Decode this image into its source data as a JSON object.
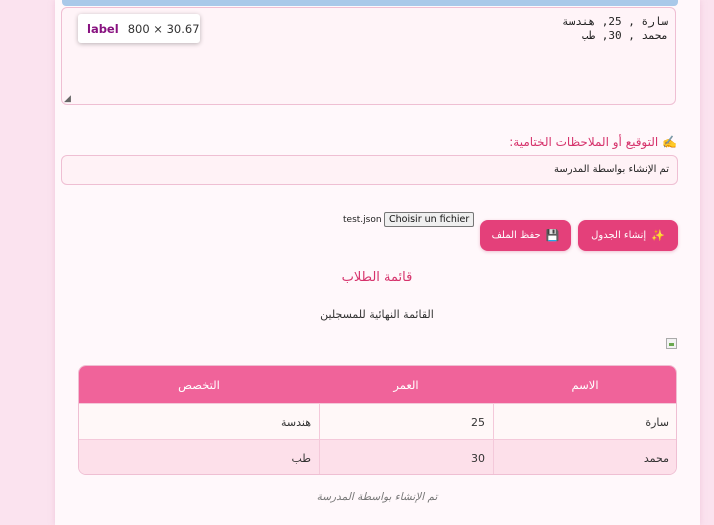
{
  "notes_textarea": {
    "lines": [
      "سارة , 25, هندسة",
      "محمد , 30, طب"
    ]
  },
  "devtools_tooltip": {
    "tag": "label",
    "dimensions": "800 × 30.67"
  },
  "signature": {
    "label": "✍️ التوقيع أو الملاحظات الختامية:",
    "value": "تم الإنشاء بواسطة المدرسة"
  },
  "file_input": {
    "button_label": "Choisir un fichier",
    "file_name": "test.json"
  },
  "buttons": {
    "generate_label": "إنشاء الجدول",
    "generate_icon": "sparkles-icon",
    "save_label": "حفظ الملف",
    "save_icon": "floppy-disk-icon"
  },
  "list": {
    "title": "قائمة الطلاب",
    "subtitle": "القائمة النهائية للمسجلين"
  },
  "table": {
    "headers": [
      "الاسم",
      "العمر",
      "التخصص"
    ],
    "rows": [
      [
        "سارة",
        "25",
        "هندسة"
      ],
      [
        "محمد",
        "30",
        "طب"
      ]
    ]
  },
  "footer": {
    "text": "تم الإنشاء بواسطة المدرسة"
  },
  "colors": {
    "accent": "#e4407a",
    "table_header": "#f0639a",
    "label_pink": "#d6336c",
    "page_background": "#fbe3ef"
  }
}
